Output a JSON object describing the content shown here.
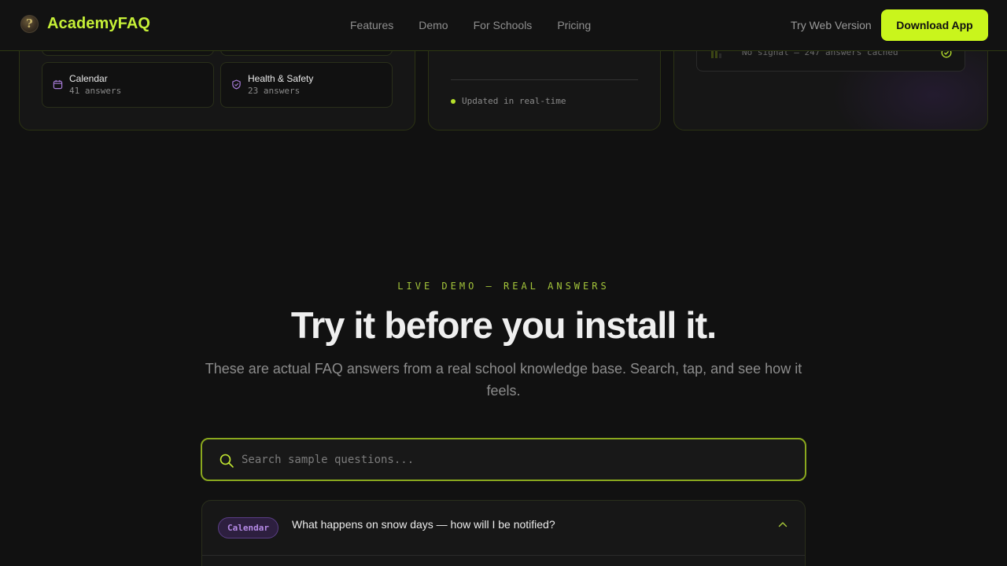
{
  "nav": {
    "brand": "AcademyFAQ",
    "links": [
      "Features",
      "Demo",
      "For Schools",
      "Pricing"
    ],
    "web_version": "Try Web Version",
    "download": "Download App"
  },
  "categories_card": {
    "items": [
      {
        "title": "Calendar",
        "count": "41 answers",
        "icon": "calendar-icon"
      },
      {
        "title": "Health & Safety",
        "count": "23 answers",
        "icon": "shield-icon"
      }
    ]
  },
  "status_card": {
    "updated": "Updated in real-time"
  },
  "offline_card": {
    "text": "No signal — 247 answers cached",
    "icon": "check-circle-icon"
  },
  "demo": {
    "eyebrow": "LIVE DEMO — REAL ANSWERS",
    "headline": "Try it before you install it.",
    "subtitle": "These are actual FAQ answers from a real school knowledge base. Search, tap, and see how it feels.",
    "search_placeholder": "Search sample questions...",
    "faq": [
      {
        "tag": "Calendar",
        "question": "What happens on snow days — how will I be notified?",
        "expanded": true
      }
    ]
  },
  "colors": {
    "accent": "#c9f51c",
    "background": "#111111",
    "tag_purple": "#b58ae6"
  }
}
